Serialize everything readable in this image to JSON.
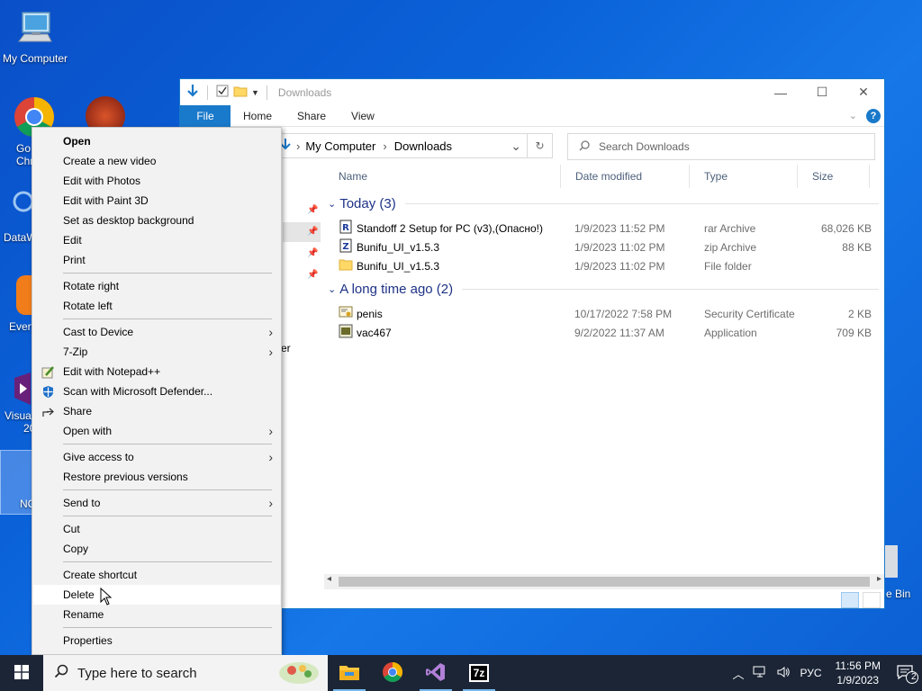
{
  "desktop": {
    "my_computer_label": "My Computer",
    "partial_labels": {
      "chrome_1": "Go",
      "chrome_2": "Chr",
      "dataw": "DataW",
      "every": "Every",
      "visual_1": "Visua",
      "visual_2": "20",
      "nc": "NC",
      "recycle": "e Bin",
      "explorer_edge": "er"
    }
  },
  "explorer": {
    "title": "Downloads",
    "window_controls": {
      "minimize": "—",
      "maximize": "☐",
      "close": "✕"
    },
    "ribbon_tabs": [
      "File",
      "Home",
      "Share",
      "View"
    ],
    "help_label": "?",
    "breadcrumb": [
      "My Computer",
      "Downloads"
    ],
    "search_placeholder": "Search Downloads",
    "columns": {
      "name": "Name",
      "date": "Date modified",
      "type": "Type",
      "size": "Size"
    },
    "groups": [
      {
        "label": "Today (3)",
        "files": [
          {
            "name": "Standoff 2 Setup for PC (v3),(Опасно!)",
            "date": "1/9/2023 11:52 PM",
            "type": "rar Archive",
            "size": "68,026 KB",
            "icon": "rar-icon"
          },
          {
            "name": "Bunifu_UI_v1.5.3",
            "date": "1/9/2023 11:02 PM",
            "type": "zip Archive",
            "size": "88 KB",
            "icon": "zip-icon"
          },
          {
            "name": "Bunifu_UI_v1.5.3",
            "date": "1/9/2023 11:02 PM",
            "type": "File folder",
            "size": "",
            "icon": "folder-icon"
          }
        ]
      },
      {
        "label": "A long time ago (2)",
        "files": [
          {
            "name": "penis",
            "date": "10/17/2022 7:58 PM",
            "type": "Security Certificate",
            "size": "2 KB",
            "icon": "certificate-icon"
          },
          {
            "name": "vac467",
            "date": "9/2/2022 11:37 AM",
            "type": "Application",
            "size": "709 KB",
            "icon": "application-icon"
          }
        ]
      }
    ]
  },
  "context_menu": {
    "items": [
      {
        "label": "Open",
        "bold": true
      },
      {
        "label": "Create a new video"
      },
      {
        "label": "Edit with Photos"
      },
      {
        "label": "Edit with Paint 3D"
      },
      {
        "label": "Set as desktop background"
      },
      {
        "label": "Edit"
      },
      {
        "label": "Print"
      },
      {
        "label": "Rotate right"
      },
      {
        "label": "Rotate left"
      },
      {
        "label": "Cast to Device",
        "submenu": true
      },
      {
        "label": "7-Zip",
        "submenu": true
      },
      {
        "label": "Edit with Notepad++",
        "icon": "notepadpp-icon"
      },
      {
        "label": "Scan with Microsoft Defender...",
        "icon": "defender-icon"
      },
      {
        "label": "Share",
        "icon": "share-icon"
      },
      {
        "label": "Open with",
        "submenu": true
      },
      {
        "label": "Give access to",
        "submenu": true
      },
      {
        "label": "Restore previous versions"
      },
      {
        "label": "Send to",
        "submenu": true
      },
      {
        "label": "Cut"
      },
      {
        "label": "Copy"
      },
      {
        "label": "Create shortcut"
      },
      {
        "label": "Delete",
        "highlighted": true
      },
      {
        "label": "Rename"
      },
      {
        "label": "Properties"
      }
    ],
    "submenu_arrow": "›"
  },
  "taskbar": {
    "search_placeholder": "Type here to search",
    "apps": [
      "file-explorer-icon",
      "chrome-icon",
      "visual-studio-icon",
      "7zip-icon"
    ],
    "sevenzip_label": "7z",
    "language": "РУС",
    "time": "11:56 PM",
    "date": "1/9/2023",
    "notifications": "2"
  },
  "colors": {
    "accent": "#1979ca",
    "group_text": "#1e3287",
    "taskbar": "#1b2536"
  }
}
